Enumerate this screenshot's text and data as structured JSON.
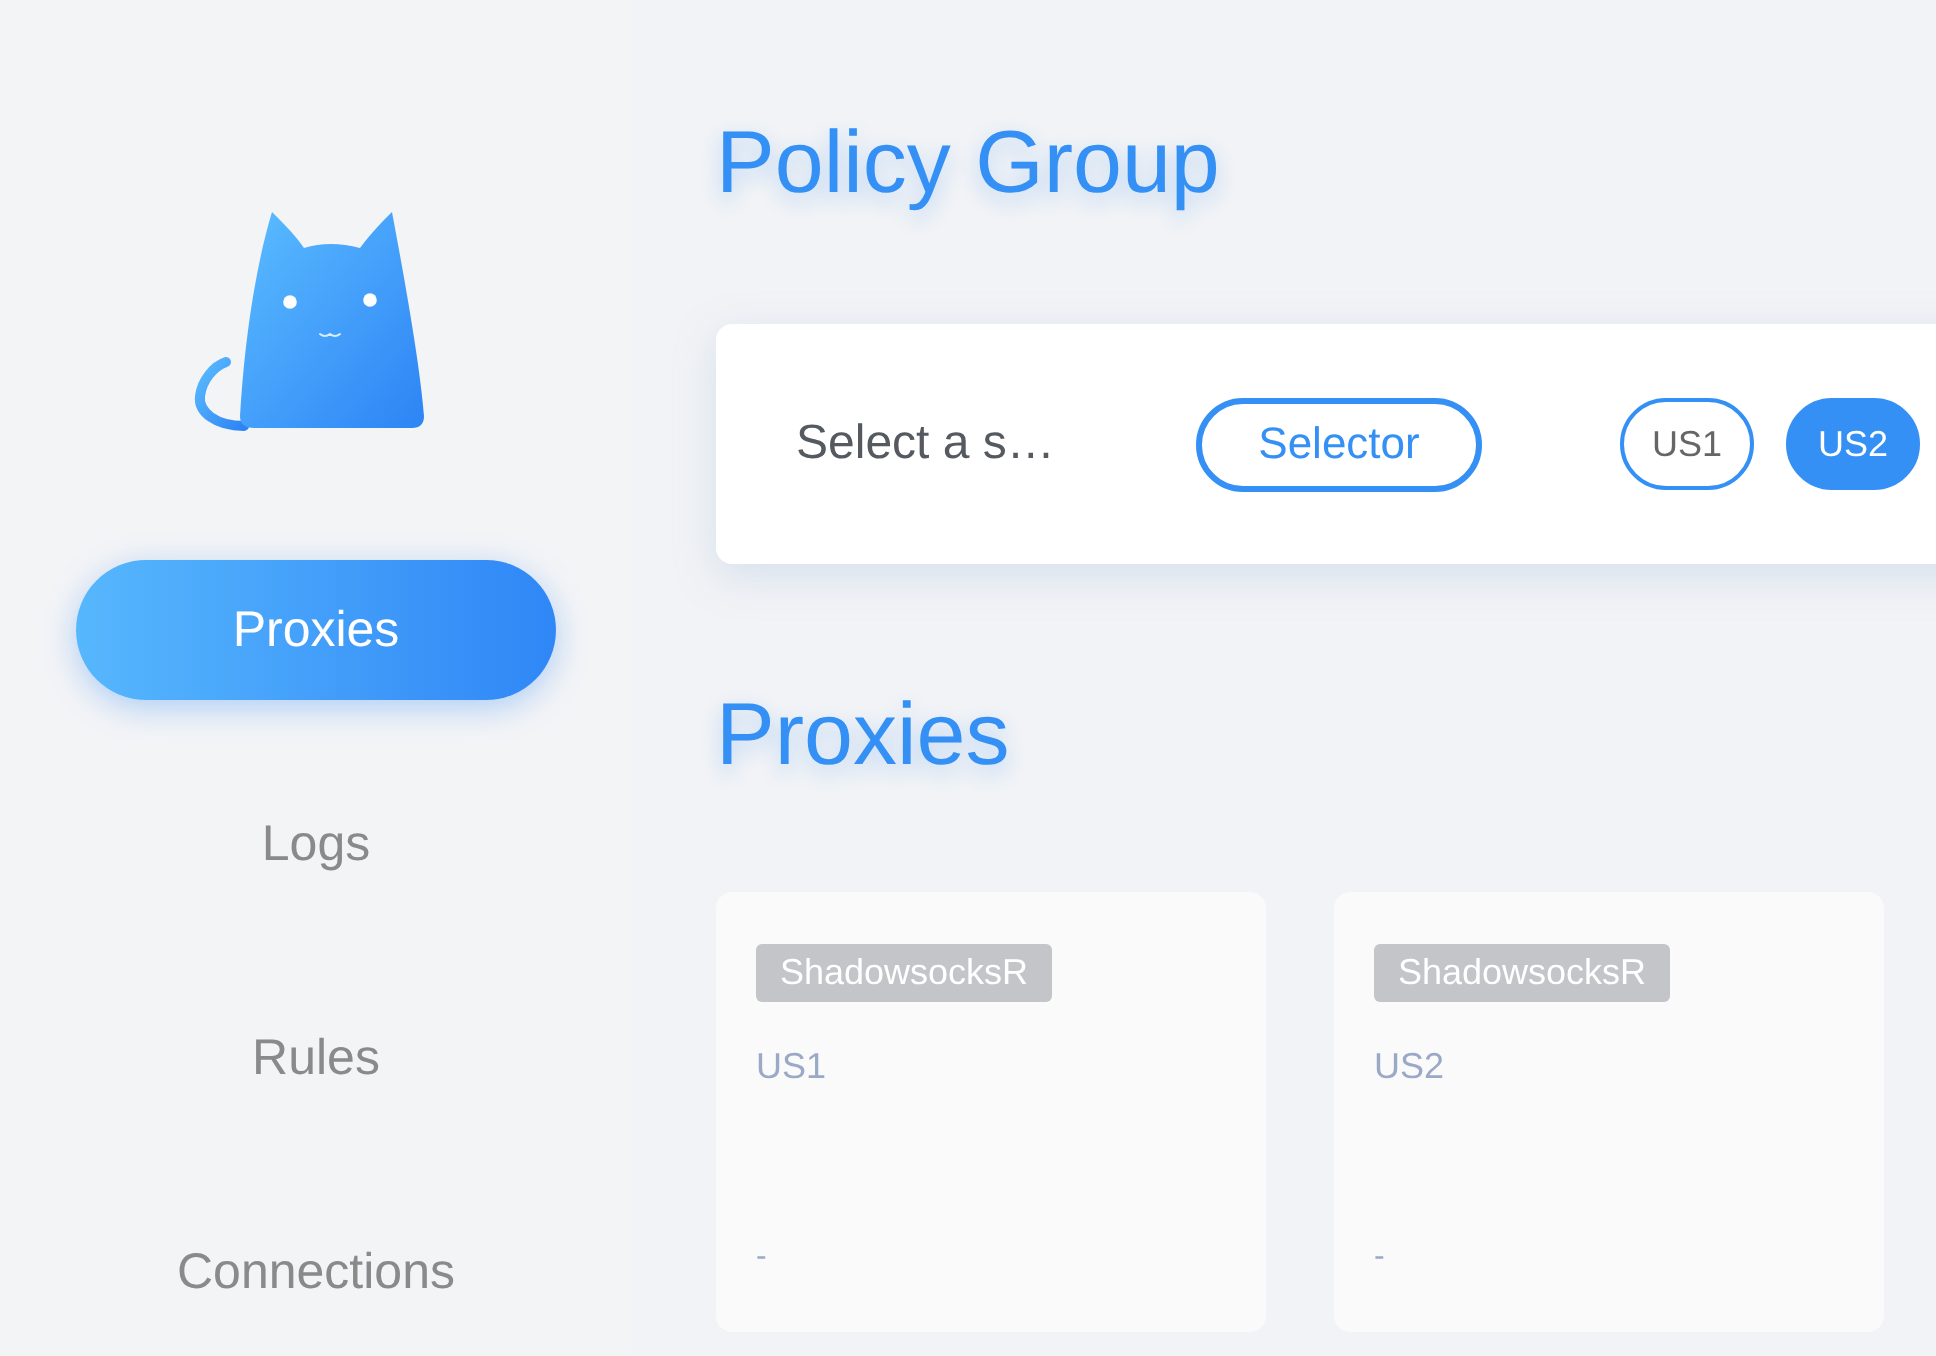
{
  "nav": {
    "items": [
      {
        "label": "Proxies",
        "selected": true
      },
      {
        "label": "Logs",
        "selected": false
      },
      {
        "label": "Rules",
        "selected": false
      },
      {
        "label": "Connections",
        "selected": false
      }
    ]
  },
  "policy_group": {
    "title": "Policy Group",
    "groups": [
      {
        "name": "Select a s…",
        "type": "Selector",
        "options": [
          {
            "label": "US1",
            "selected": false
          },
          {
            "label": "US2",
            "selected": true
          }
        ]
      }
    ]
  },
  "proxies": {
    "title": "Proxies",
    "items": [
      {
        "type": "ShadowsocksR",
        "name": "US1",
        "latency": "-"
      },
      {
        "type": "ShadowsocksR",
        "name": "US2",
        "latency": "-"
      }
    ]
  }
}
